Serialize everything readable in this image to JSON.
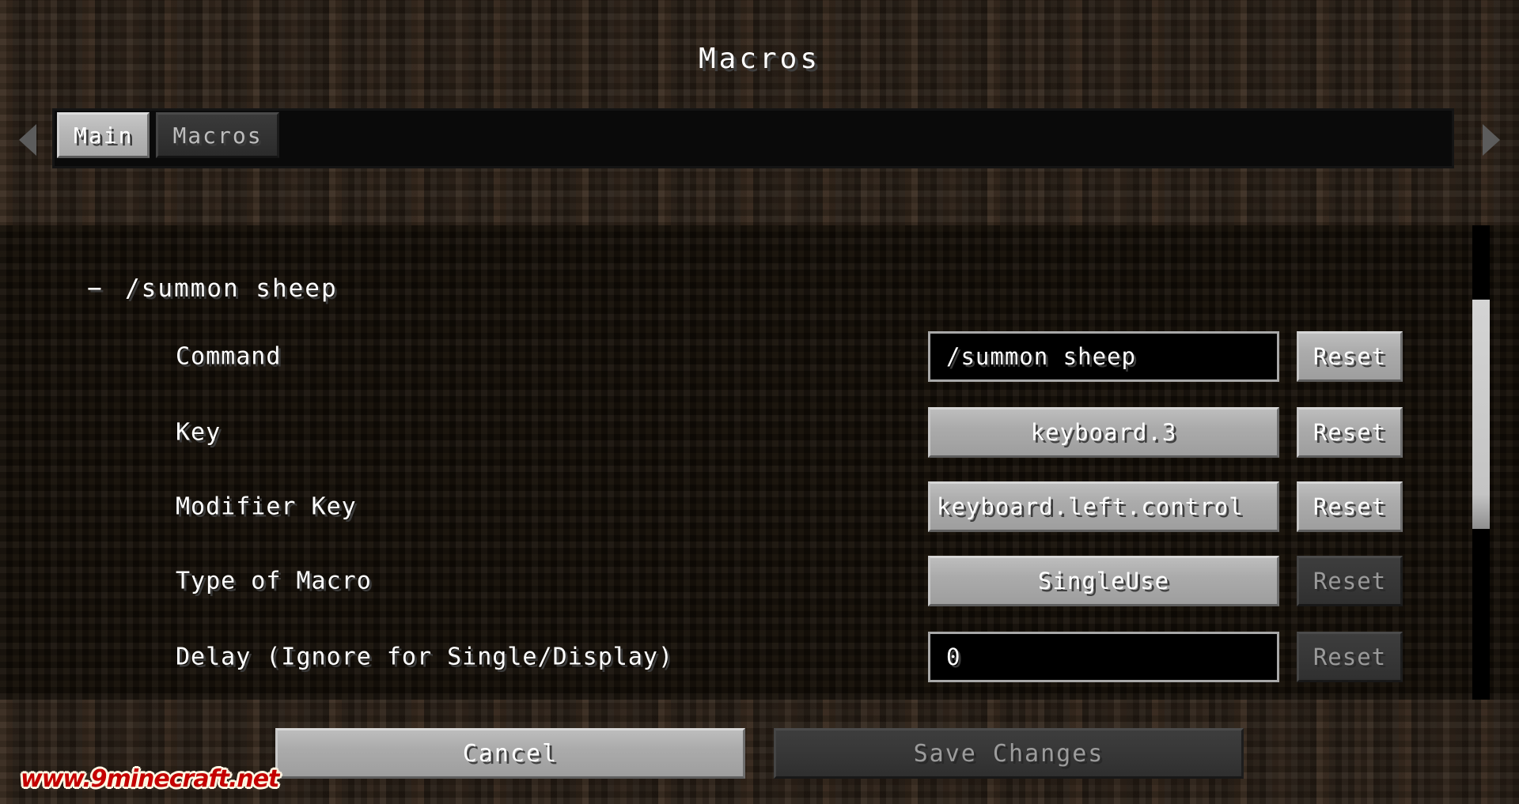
{
  "window": {
    "title": "Macros"
  },
  "tabbar": {
    "prev_arrow_icon": "chevron-left-icon",
    "next_arrow_icon": "chevron-right-icon",
    "tabs": [
      {
        "label": "Main",
        "active": true
      },
      {
        "label": "Macros",
        "active": false
      }
    ]
  },
  "content": {
    "group": {
      "collapse_indicator": "−",
      "label": "/summon sheep"
    },
    "rows": [
      {
        "label": "Command",
        "value": "/summon sheep",
        "control": "textbox",
        "align": "left",
        "reset_label": "Reset",
        "reset_enabled": true
      },
      {
        "label": "Key",
        "value": "keyboard.3",
        "control": "button",
        "align": "center",
        "reset_label": "Reset",
        "reset_enabled": true
      },
      {
        "label": "Modifier Key",
        "value": "keyboard.left.control",
        "control": "button",
        "align": "left",
        "reset_label": "Reset",
        "reset_enabled": true
      },
      {
        "label": "Type of Macro",
        "value": "SingleUse",
        "control": "button",
        "align": "center",
        "reset_label": "Reset",
        "reset_enabled": false
      },
      {
        "label": "Delay (Ignore for Single/Display)",
        "value": "0",
        "control": "textbox",
        "align": "left",
        "reset_label": "Reset",
        "reset_enabled": false
      }
    ],
    "scrollbar": {
      "name": "vertical-scrollbar"
    }
  },
  "footer": {
    "cancel_label": "Cancel",
    "save_label": "Save Changes",
    "save_enabled": false
  },
  "watermark": {
    "text": "www.9minecraft.net"
  },
  "colors": {
    "background_dirt": "#2b2118",
    "panel_dark": "#161008",
    "button_gray": "#ababab",
    "button_disabled": "#373737",
    "text_white": "#ffffff",
    "text_shadow": "#3f3f3f",
    "watermark_red": "#c40000",
    "watermark_outline": "#fdf6e3",
    "scrollbar_thumb": "#c4c4c4"
  }
}
